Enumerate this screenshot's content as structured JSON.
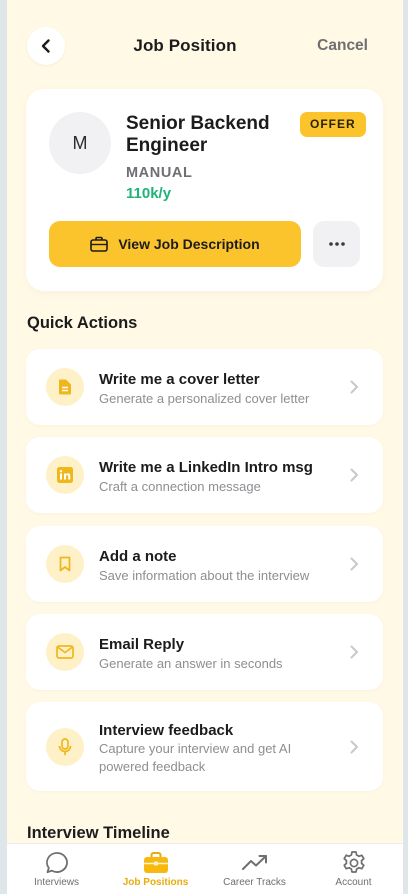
{
  "header": {
    "title": "Job Position",
    "cancel_label": "Cancel"
  },
  "job": {
    "avatar_initial": "M",
    "title": "Senior Backend Engineer",
    "status_badge": "OFFER",
    "type": "MANUAL",
    "salary": "110k/y",
    "view_description_label": "View Job Description"
  },
  "quick_actions": {
    "title": "Quick Actions",
    "items": [
      {
        "title": "Write me a cover letter",
        "subtitle": "Generate a personalized cover letter",
        "icon": "document-icon"
      },
      {
        "title": "Write me a LinkedIn Intro msg",
        "subtitle": "Craft a connection message",
        "icon": "linkedin-icon"
      },
      {
        "title": "Add a note",
        "subtitle": "Save information about the interview",
        "icon": "bookmark-icon"
      },
      {
        "title": "Email Reply",
        "subtitle": "Generate an answer in seconds",
        "icon": "mail-icon"
      },
      {
        "title": "Interview feedback",
        "subtitle": "Capture your interview and get AI powered feedback",
        "icon": "microphone-icon"
      }
    ]
  },
  "timeline": {
    "title": "Interview Timeline"
  },
  "tabbar": {
    "items": [
      {
        "label": "Interviews",
        "icon": "chat-bubble-icon",
        "active": false
      },
      {
        "label": "Job Positions",
        "icon": "briefcase-icon",
        "active": true
      },
      {
        "label": "Career Tracks",
        "icon": "trending-up-icon",
        "active": false
      },
      {
        "label": "Account",
        "icon": "gear-icon",
        "active": false
      }
    ]
  },
  "colors": {
    "accent": "#fcc42c",
    "background": "#fff9e5",
    "salary": "#1db37a",
    "active_tab": "#e8ac0c"
  }
}
